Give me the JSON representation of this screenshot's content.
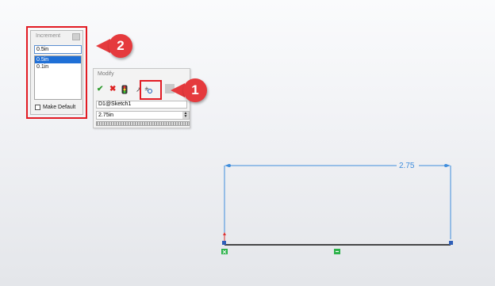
{
  "increment_panel": {
    "title": "Increment",
    "current_value": "0.5in",
    "options": [
      "0.5in",
      "0.1in"
    ],
    "selected_index": 0,
    "make_default_label": "Make Default",
    "make_default_checked": false
  },
  "modify_dialog": {
    "title": "Modify",
    "toolbar": {
      "ok_icon": "checkmark-icon",
      "cancel_icon": "x-icon",
      "rebuild_icon": "traffic-light-icon",
      "reverse_icon": "arrow-icon",
      "increment_icon": "plus-minus-icon"
    },
    "dimension_name": "D1@Sketch1",
    "value": "2.75in"
  },
  "callouts": {
    "one": "1",
    "two": "2"
  },
  "sketch": {
    "dimension_label": "2.75"
  },
  "colors": {
    "callout": "#e53a3d",
    "highlight": "#e21b23",
    "dimension": "#3f8ddc",
    "selection": "#1f6fd6"
  }
}
